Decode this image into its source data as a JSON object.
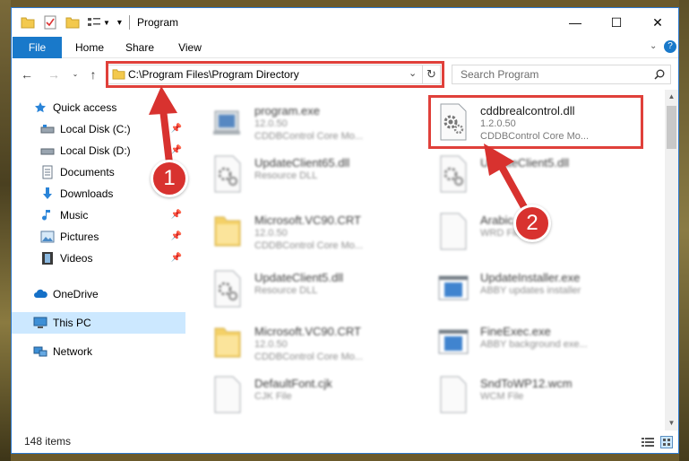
{
  "window": {
    "title": "Program",
    "controls": {
      "minimize": "—",
      "maximize": "☐",
      "close": "✕"
    }
  },
  "ribbon": {
    "tabs": [
      {
        "label": "File"
      },
      {
        "label": "Home"
      },
      {
        "label": "Share"
      },
      {
        "label": "View"
      }
    ],
    "help": "?"
  },
  "address": {
    "path": "C:\\Program Files\\Program Directory",
    "search_placeholder": "Search Program"
  },
  "nav": {
    "items": [
      {
        "label": "Quick access",
        "icon": "star-icon",
        "pinned": false
      },
      {
        "label": "Local Disk (C:)",
        "icon": "drive-icon",
        "pinned": true
      },
      {
        "label": "Local Disk (D:)",
        "icon": "drive-icon",
        "pinned": true
      },
      {
        "label": "Documents",
        "icon": "documents-icon",
        "pinned": false
      },
      {
        "label": "Downloads",
        "icon": "download-icon",
        "pinned": false
      },
      {
        "label": "Music",
        "icon": "music-icon",
        "pinned": true
      },
      {
        "label": "Pictures",
        "icon": "pictures-icon",
        "pinned": true
      },
      {
        "label": "Videos",
        "icon": "videos-icon",
        "pinned": true
      },
      {
        "label": "OneDrive",
        "icon": "cloud-icon",
        "pinned": false
      },
      {
        "label": "This PC",
        "icon": "pc-icon",
        "pinned": false,
        "selected": true
      },
      {
        "label": "Network",
        "icon": "network-icon",
        "pinned": false
      }
    ]
  },
  "files": [
    {
      "name": "program.exe",
      "line2": "12.0.50",
      "line3": "CDDBControl Core Mo...",
      "icon": "exe-icon",
      "highlight": false
    },
    {
      "name": "cddbrealcontrol.dll",
      "line2": "1.2.0.50",
      "line3": "CDDBControl Core Mo...",
      "icon": "dll-gear-icon",
      "highlight": true
    },
    {
      "name": "UpdateClient65.dll",
      "line2": "Resource DLL",
      "line3": "",
      "icon": "dll-gear-icon",
      "highlight": false
    },
    {
      "name": "UpdateClient5.dll",
      "line2": "",
      "line3": "",
      "icon": "dll-gear-icon",
      "highlight": false
    },
    {
      "name": "Microsoft.VC90.CRT",
      "line2": "12.0.50",
      "line3": "CDDBControl Core Mo...",
      "icon": "folder-icon",
      "highlight": false
    },
    {
      "name": "Arabic.w",
      "line2": "WRD File",
      "line3": "",
      "icon": "blank-file-icon",
      "highlight": false
    },
    {
      "name": "UpdateClient5.dll",
      "line2": "Resource DLL",
      "line3": "",
      "icon": "dll-gear-icon",
      "highlight": false
    },
    {
      "name": "UpdateInstaller.exe",
      "line2": "ABBY updates installer",
      "line3": "",
      "icon": "app-window-icon",
      "highlight": false
    },
    {
      "name": "Microsoft.VC90.CRT",
      "line2": "12.0.50",
      "line3": "CDDBControl Core Mo...",
      "icon": "folder-icon",
      "highlight": false
    },
    {
      "name": "FineExec.exe",
      "line2": "ABBY background exe...",
      "line3": "",
      "icon": "app-window-icon",
      "highlight": false
    },
    {
      "name": "DefaultFont.cjk",
      "line2": "CJK File",
      "line3": "",
      "icon": "blank-file-icon",
      "highlight": false
    },
    {
      "name": "SndToWP12.wcm",
      "line2": "WCM File",
      "line3": "",
      "icon": "blank-file-icon",
      "highlight": false
    }
  ],
  "status": {
    "count": "148 items"
  },
  "annotations": {
    "step1": "1",
    "step2": "2",
    "color": "#e0403a"
  },
  "colors": {
    "accent": "#1979ca",
    "selected": "#cce8ff"
  }
}
